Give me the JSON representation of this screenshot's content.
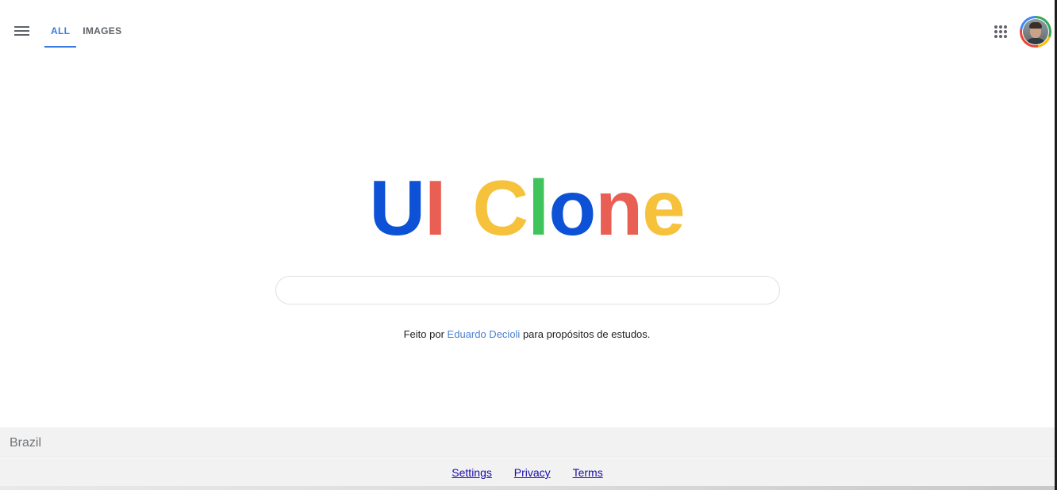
{
  "header": {
    "tabs": [
      {
        "label": "ALL",
        "active": true
      },
      {
        "label": "IMAGES",
        "active": false
      }
    ],
    "menu_icon": "hamburger-menu-icon",
    "apps_icon": "apps-grid-icon",
    "avatar_icon": "user-avatar"
  },
  "logo": {
    "letters": [
      {
        "char": "U",
        "color": "#0d52d6"
      },
      {
        "char": "I",
        "color": "#ea5f53"
      },
      {
        "char": " ",
        "color": "#ffffff"
      },
      {
        "char": "C",
        "color": "#f6c23b"
      },
      {
        "char": "l",
        "color": "#3fc45c"
      },
      {
        "char": "o",
        "color": "#0d52d6"
      },
      {
        "char": "n",
        "color": "#ea5f53"
      },
      {
        "char": "e",
        "color": "#f6c23b"
      }
    ]
  },
  "search": {
    "value": "",
    "placeholder": ""
  },
  "credit": {
    "prefix": "Feito por",
    "author": "Eduardo Decioli",
    "suffix": "para propósitos de estudos."
  },
  "footer": {
    "country": "Brazil",
    "links": [
      {
        "label": "Settings"
      },
      {
        "label": "Privacy"
      },
      {
        "label": "Terms"
      }
    ]
  },
  "colors": {
    "accent": "#3b7ae0",
    "footer_bg": "#f2f2f2",
    "link": "#1a0dab"
  }
}
